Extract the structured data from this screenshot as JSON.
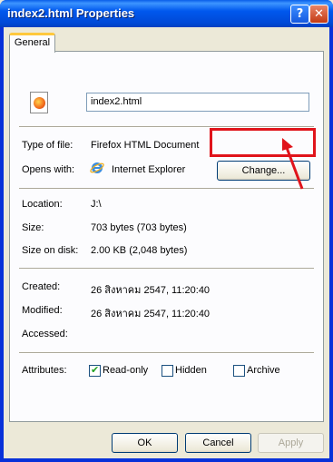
{
  "window": {
    "title": "index2.html Properties"
  },
  "titlebar": {
    "help_glyph": "?",
    "close_glyph": "✕"
  },
  "tabs": [
    {
      "label": "General"
    }
  ],
  "file": {
    "name": "index2.html",
    "type_label": "Type of file:",
    "type_value": "Firefox HTML Document",
    "opens_label": "Opens with:",
    "opens_value": "Internet Explorer",
    "change_label": "Change...",
    "location_label": "Location:",
    "location_value": "J:\\",
    "size_label": "Size:",
    "size_value": "703 bytes (703 bytes)",
    "size_disk_label": "Size on disk:",
    "size_disk_value": "2.00 KB (2,048 bytes)",
    "created_label": "Created:",
    "created_value": "26 สิงหาคม 2547, 11:20:40",
    "modified_label": "Modified:",
    "modified_value": "26 สิงหาคม 2547, 11:20:40",
    "accessed_label": "Accessed:",
    "accessed_value": ""
  },
  "attributes": {
    "label": "Attributes:",
    "readonly": {
      "label": "Read-only",
      "checked": true
    },
    "hidden": {
      "label": "Hidden",
      "checked": false
    },
    "archive": {
      "label": "Archive",
      "checked": false
    }
  },
  "footer": {
    "ok_label": "OK",
    "cancel_label": "Cancel",
    "apply_label": "Apply"
  },
  "colors": {
    "titlebar": "#0058ee",
    "highlight": "#e0141b",
    "face": "#ece9d8"
  }
}
